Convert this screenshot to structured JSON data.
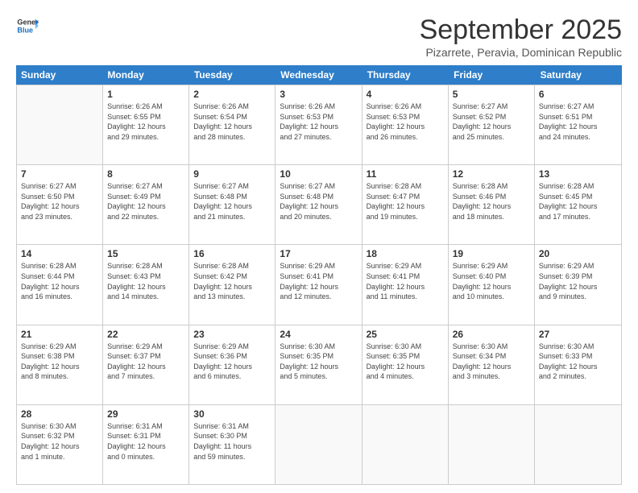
{
  "logo": {
    "line1": "General",
    "line2": "Blue"
  },
  "title": "September 2025",
  "subtitle": "Pizarrete, Peravia, Dominican Republic",
  "days_of_week": [
    "Sunday",
    "Monday",
    "Tuesday",
    "Wednesday",
    "Thursday",
    "Friday",
    "Saturday"
  ],
  "weeks": [
    [
      {
        "day": "",
        "info": ""
      },
      {
        "day": "1",
        "info": "Sunrise: 6:26 AM\nSunset: 6:55 PM\nDaylight: 12 hours\nand 29 minutes."
      },
      {
        "day": "2",
        "info": "Sunrise: 6:26 AM\nSunset: 6:54 PM\nDaylight: 12 hours\nand 28 minutes."
      },
      {
        "day": "3",
        "info": "Sunrise: 6:26 AM\nSunset: 6:53 PM\nDaylight: 12 hours\nand 27 minutes."
      },
      {
        "day": "4",
        "info": "Sunrise: 6:26 AM\nSunset: 6:53 PM\nDaylight: 12 hours\nand 26 minutes."
      },
      {
        "day": "5",
        "info": "Sunrise: 6:27 AM\nSunset: 6:52 PM\nDaylight: 12 hours\nand 25 minutes."
      },
      {
        "day": "6",
        "info": "Sunrise: 6:27 AM\nSunset: 6:51 PM\nDaylight: 12 hours\nand 24 minutes."
      }
    ],
    [
      {
        "day": "7",
        "info": "Sunrise: 6:27 AM\nSunset: 6:50 PM\nDaylight: 12 hours\nand 23 minutes."
      },
      {
        "day": "8",
        "info": "Sunrise: 6:27 AM\nSunset: 6:49 PM\nDaylight: 12 hours\nand 22 minutes."
      },
      {
        "day": "9",
        "info": "Sunrise: 6:27 AM\nSunset: 6:48 PM\nDaylight: 12 hours\nand 21 minutes."
      },
      {
        "day": "10",
        "info": "Sunrise: 6:27 AM\nSunset: 6:48 PM\nDaylight: 12 hours\nand 20 minutes."
      },
      {
        "day": "11",
        "info": "Sunrise: 6:28 AM\nSunset: 6:47 PM\nDaylight: 12 hours\nand 19 minutes."
      },
      {
        "day": "12",
        "info": "Sunrise: 6:28 AM\nSunset: 6:46 PM\nDaylight: 12 hours\nand 18 minutes."
      },
      {
        "day": "13",
        "info": "Sunrise: 6:28 AM\nSunset: 6:45 PM\nDaylight: 12 hours\nand 17 minutes."
      }
    ],
    [
      {
        "day": "14",
        "info": "Sunrise: 6:28 AM\nSunset: 6:44 PM\nDaylight: 12 hours\nand 16 minutes."
      },
      {
        "day": "15",
        "info": "Sunrise: 6:28 AM\nSunset: 6:43 PM\nDaylight: 12 hours\nand 14 minutes."
      },
      {
        "day": "16",
        "info": "Sunrise: 6:28 AM\nSunset: 6:42 PM\nDaylight: 12 hours\nand 13 minutes."
      },
      {
        "day": "17",
        "info": "Sunrise: 6:29 AM\nSunset: 6:41 PM\nDaylight: 12 hours\nand 12 minutes."
      },
      {
        "day": "18",
        "info": "Sunrise: 6:29 AM\nSunset: 6:41 PM\nDaylight: 12 hours\nand 11 minutes."
      },
      {
        "day": "19",
        "info": "Sunrise: 6:29 AM\nSunset: 6:40 PM\nDaylight: 12 hours\nand 10 minutes."
      },
      {
        "day": "20",
        "info": "Sunrise: 6:29 AM\nSunset: 6:39 PM\nDaylight: 12 hours\nand 9 minutes."
      }
    ],
    [
      {
        "day": "21",
        "info": "Sunrise: 6:29 AM\nSunset: 6:38 PM\nDaylight: 12 hours\nand 8 minutes."
      },
      {
        "day": "22",
        "info": "Sunrise: 6:29 AM\nSunset: 6:37 PM\nDaylight: 12 hours\nand 7 minutes."
      },
      {
        "day": "23",
        "info": "Sunrise: 6:29 AM\nSunset: 6:36 PM\nDaylight: 12 hours\nand 6 minutes."
      },
      {
        "day": "24",
        "info": "Sunrise: 6:30 AM\nSunset: 6:35 PM\nDaylight: 12 hours\nand 5 minutes."
      },
      {
        "day": "25",
        "info": "Sunrise: 6:30 AM\nSunset: 6:35 PM\nDaylight: 12 hours\nand 4 minutes."
      },
      {
        "day": "26",
        "info": "Sunrise: 6:30 AM\nSunset: 6:34 PM\nDaylight: 12 hours\nand 3 minutes."
      },
      {
        "day": "27",
        "info": "Sunrise: 6:30 AM\nSunset: 6:33 PM\nDaylight: 12 hours\nand 2 minutes."
      }
    ],
    [
      {
        "day": "28",
        "info": "Sunrise: 6:30 AM\nSunset: 6:32 PM\nDaylight: 12 hours\nand 1 minute."
      },
      {
        "day": "29",
        "info": "Sunrise: 6:31 AM\nSunset: 6:31 PM\nDaylight: 12 hours\nand 0 minutes."
      },
      {
        "day": "30",
        "info": "Sunrise: 6:31 AM\nSunset: 6:30 PM\nDaylight: 11 hours\nand 59 minutes."
      },
      {
        "day": "",
        "info": ""
      },
      {
        "day": "",
        "info": ""
      },
      {
        "day": "",
        "info": ""
      },
      {
        "day": "",
        "info": ""
      }
    ]
  ]
}
